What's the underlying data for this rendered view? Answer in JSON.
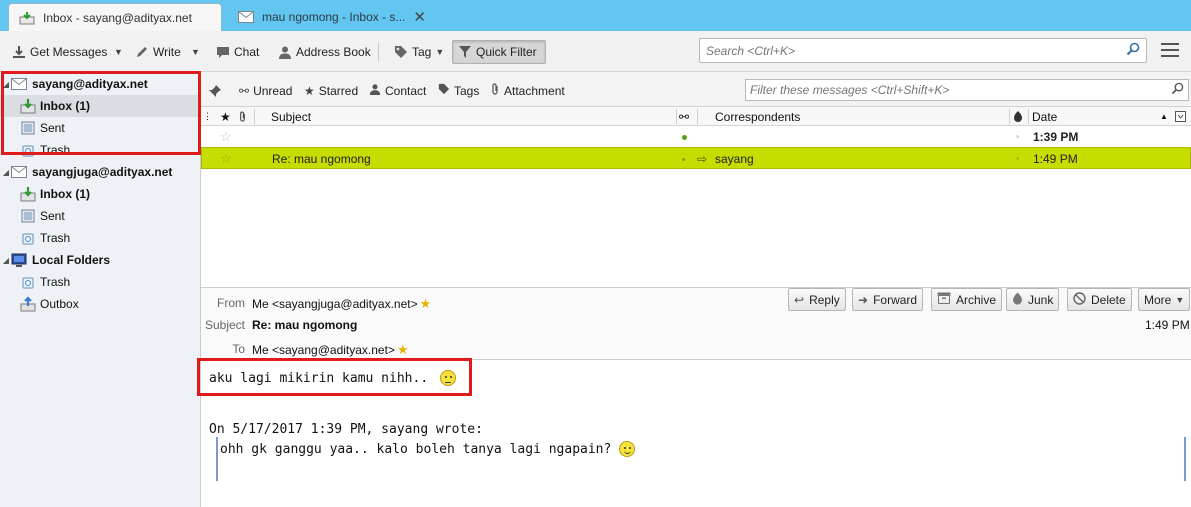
{
  "tabs": [
    {
      "label": "Inbox - sayang@adityax.net",
      "icon": "inbox-download-icon",
      "active": true
    },
    {
      "label": "mau ngomong - Inbox - s...",
      "icon": "envelope-icon",
      "active": false
    }
  ],
  "toolbar": {
    "get_messages": "Get Messages",
    "write": "Write",
    "chat": "Chat",
    "address_book": "Address Book",
    "tag": "Tag",
    "quick_filter": "Quick Filter",
    "search_placeholder": "Search <Ctrl+K>"
  },
  "folders": [
    {
      "label": "sayang@adityax.net",
      "type": "account",
      "icon": "envelope-icon"
    },
    {
      "label": "Inbox (1)",
      "type": "folder",
      "icon": "inbox-download-icon",
      "bold": true,
      "selected": true
    },
    {
      "label": "Sent",
      "type": "folder",
      "icon": "sent-folder-icon"
    },
    {
      "label": "Trash",
      "type": "folder",
      "icon": "trash-icon"
    },
    {
      "label": "sayangjuga@adityax.net",
      "type": "account",
      "icon": "envelope-icon"
    },
    {
      "label": "Inbox (1)",
      "type": "folder",
      "icon": "inbox-download-icon",
      "bold": true
    },
    {
      "label": "Sent",
      "type": "folder",
      "icon": "sent-folder-icon"
    },
    {
      "label": "Trash",
      "type": "folder",
      "icon": "trash-icon"
    },
    {
      "label": "Local Folders",
      "type": "account",
      "icon": "computer-icon"
    },
    {
      "label": "Trash",
      "type": "folder",
      "icon": "trash-icon"
    },
    {
      "label": "Outbox",
      "type": "folder",
      "icon": "outbox-icon"
    }
  ],
  "quick_filter": {
    "unread": "Unread",
    "starred": "Starred",
    "contact": "Contact",
    "tags": "Tags",
    "attachment": "Attachment",
    "filter_placeholder": "Filter these messages <Ctrl+Shift+K>"
  },
  "thread_columns": {
    "subject": "Subject",
    "correspondents": "Correspondents",
    "date": "Date"
  },
  "threads": [
    {
      "subject": "",
      "correspondent": "",
      "date": "1:39 PM",
      "unread": true,
      "highlighted": false
    },
    {
      "subject": "Re: mau ngomong",
      "correspondent": "sayang",
      "date": "1:49 PM",
      "unread": false,
      "highlighted": true
    }
  ],
  "message": {
    "from_label": "From",
    "from": "Me <sayangjuga@adityax.net>",
    "subject_label": "Subject",
    "subject": "Re: mau ngomong",
    "to_label": "To",
    "to": "Me <sayang@adityax.net>",
    "time": "1:49 PM",
    "actions": {
      "reply": "Reply",
      "forward": "Forward",
      "archive": "Archive",
      "junk": "Junk",
      "delete": "Delete",
      "more": "More"
    },
    "body_line": "aku lagi mikirin kamu nihh..",
    "attribution": "On 5/17/2017 1:39 PM, sayang wrote:",
    "quoted": "ohh gk ganggu yaa.. kalo boleh tanya lagi ngapain?"
  },
  "colors": {
    "tabstrip": "#62c6f0",
    "highlight_row": "#c5dd00",
    "annotation_box": "#e01b1b",
    "quote_bar": "#7a9ccb"
  }
}
